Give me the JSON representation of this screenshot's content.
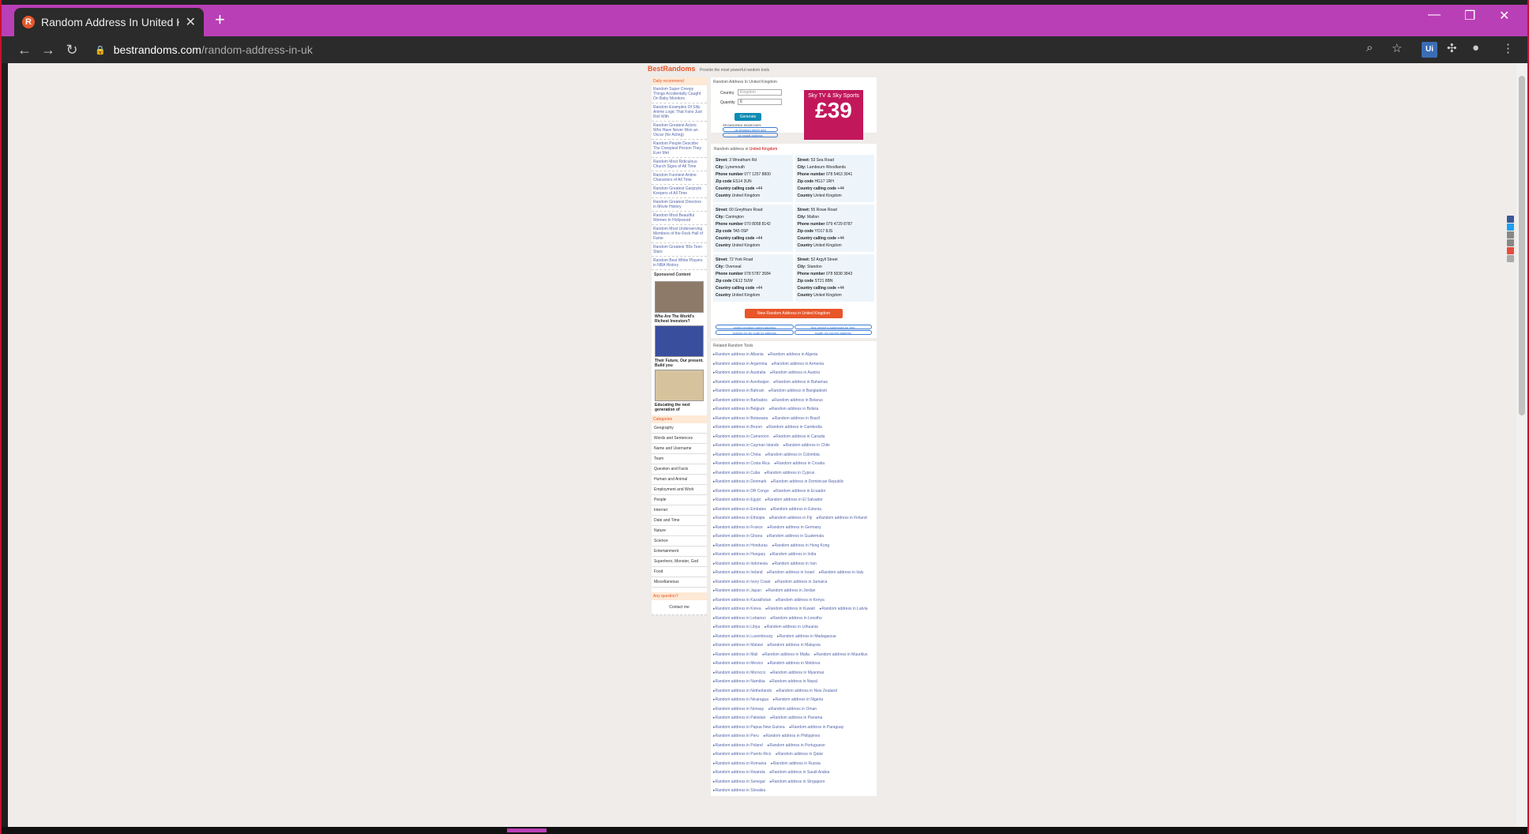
{
  "browser": {
    "tab_title": "Random Address In United Kingdom",
    "favicon": "R",
    "new_tab": "+",
    "url_domain": "bestrandoms.com",
    "url_path": "/random-address-in-uk",
    "ext_label": "Ui",
    "accent_color": "#b93fb6"
  },
  "site": {
    "logo": "BestRandoms",
    "tagline": "Provide the most powerful random tools",
    "sidebar": {
      "daily_header": "Daily recommend",
      "daily_items": [
        "Random Super Creepy Things Accidentally Caught On Baby Monitors",
        "Random Examples Of Silly Anime Logic That Fans Just Roll With",
        "Random Greatest Actors Who Have Never Won an Oscar (for Acting)",
        "Random People Describe The Creepiest Person They Ever Met",
        "Random Most Ridiculous Church Signs of All Time",
        "Random Funniest Anime Characters of All Time",
        "Random Greatest Gargoyle Keepers of All Time",
        "Random Greatest Directors in Movie History",
        "Random Most Beautiful Women In Hollywood",
        "Random Most Underserving Members of the Rock Hall of Fame",
        "Random Greatest '80s Teen Stars",
        "Random Best White Players in NBA History"
      ],
      "sponsored_header": "Sponsored Content",
      "sponsored": [
        "Who Are The World's Richest Investors?",
        "Their Future, Our present. Build you",
        "Educating the next generation of"
      ],
      "categories_header": "Categories",
      "categories": [
        "Geography",
        "Words and Sentences",
        "Name and Username",
        "Team",
        "Question and Facts",
        "Human and Animal",
        "Employment and Work",
        "People",
        "Internet",
        "Date and Time",
        "Nature",
        "Science",
        "Entertainment",
        "Superhero, Monster, God",
        "Food",
        "Miscellaneous"
      ],
      "question_header": "Any question?",
      "contact": "Contact me"
    },
    "main": {
      "breadcrumb": "Random Address In United Kingdom",
      "country_label": "Country",
      "country_value": "Kingdom",
      "quantity_label": "Quantity",
      "quantity_value": "6",
      "generate": "Generate",
      "sponsored_searches": "SPONSORED SEARCHES",
      "search_links": [
        "uk kingdom street add",
        "uk postal address"
      ],
      "ad_line1": "Sky TV & Sky Sports",
      "ad_price": "£39",
      "results_prefix": "Random address in",
      "results_country": "United Kingdom",
      "addresses": [
        {
          "street": "3 Wreatham Rd",
          "city": "Lynemouth",
          "phone": "077 1257 8800",
          "zip": "ES14 3UN",
          "calling": "+44",
          "country": "United Kingdom"
        },
        {
          "street": "53 Sea Road",
          "city": "Lambourn Woodlands",
          "phone": "078 5463 3941",
          "zip": "HG17 1RH",
          "calling": "+44",
          "country": "United Kingdom"
        },
        {
          "street": "60 Greyfriars Road",
          "city": "Carrington",
          "phone": "070 8058 8142",
          "zip": "TA5 0SP",
          "calling": "+44",
          "country": "United Kingdom"
        },
        {
          "street": "55 Rowe Road",
          "city": "Malton",
          "phone": "079 4729 8787",
          "zip": "YO17 8JS",
          "calling": "+44",
          "country": "United Kingdom"
        },
        {
          "street": "72 York Road",
          "city": "Overseal",
          "phone": "078 5787 3584",
          "zip": "DE12 5UW",
          "calling": "+44",
          "country": "United Kingdom"
        },
        {
          "street": "52 Argyll Street",
          "city": "Standon",
          "phone": "078 5838 3843",
          "zip": "ST21 8BN",
          "calling": "+44",
          "country": "United Kingdom"
        }
      ],
      "field_labels": {
        "street": "Street:",
        "city": "City:",
        "phone": "Phone number",
        "zip": "Zip code",
        "calling": "Country calling code",
        "country": "Country"
      },
      "new_button": "New Random Address in United Kingdom",
      "bottom_search_links": [
        "united kingdom street address",
        "find people's addresses for free",
        "looking for zip code by address",
        "locate my current address"
      ],
      "related_header": "Related Random Tools",
      "related": [
        "Random address in Albania",
        "Random address in Algeria",
        "Random address in Argentina",
        "Random address in Armenia",
        "Random address in Australia",
        "Random address in Austria",
        "Random address in Azerbaijan",
        "Random address in Bahamas",
        "Random address in Bahrain",
        "Random address in Bangladesh",
        "Random address in Barbados",
        "Random address in Belarus",
        "Random address in Belgium",
        "Random address in Bolivia",
        "Random address in Botswana",
        "Random address in Brazil",
        "Random address in Brunei",
        "Random address in Cambodia",
        "Random address in Cameroon",
        "Random address in Canada",
        "Random address in Cayman Islands",
        "Random address in Chile",
        "Random address in China",
        "Random address in Colombia",
        "Random address in Costa Rica",
        "Random address in Croatia",
        "Random address in Cuba",
        "Random address in Cyprus",
        "Random address in Denmark",
        "Random address in Dominican Republic",
        "Random address in DR Congo",
        "Random address in Ecuador",
        "Random address in Egypt",
        "Random address in El Salvador",
        "Random address in Emirates",
        "Random address in Estonia",
        "Random address in Ethiopia",
        "Random address in Fiji",
        "Random address in Finland",
        "Random address in France",
        "Random address in Germany",
        "Random address in Ghana",
        "Random address in Guatemala",
        "Random address in Honduras",
        "Random address in Hong Kong",
        "Random address in Hungary",
        "Random address in India",
        "Random address in Indonesia",
        "Random address in Iran",
        "Random address in Ireland",
        "Random address in Israel",
        "Random address in Italy",
        "Random address in Ivory Coast",
        "Random address in Jamaica",
        "Random address in Japan",
        "Random address in Jordan",
        "Random address in Kazakhstan",
        "Random address in Kenya",
        "Random address in Korea",
        "Random address in Kuwait",
        "Random address in Latvia",
        "Random address in Lebanon",
        "Random address in Lesotho",
        "Random address in Libya",
        "Random address in Lithuania",
        "Random address in Luxembourg",
        "Random address in Madagascar",
        "Random address in Malawi",
        "Random address in Malaysia",
        "Random address in Mali",
        "Random address in Malta",
        "Random address in Mauritius",
        "Random address in Mexico",
        "Random address in Moldova",
        "Random address in Morocco",
        "Random address in Myanmar",
        "Random address in Namibia",
        "Random address in Nepal",
        "Random address in Netherlands",
        "Random address in New Zealand",
        "Random address in Nicaragua",
        "Random address in Nigeria",
        "Random address in Norway",
        "Random address in Oman",
        "Random address in Pakistan",
        "Random address in Panama",
        "Random address in Papua New Guinea",
        "Random address in Paraguay",
        "Random address in Peru",
        "Random address in Philippines",
        "Random address in Poland",
        "Random address in Portuguese",
        "Random address in Puerto Rico",
        "Random address in Qatar",
        "Random address in Romania",
        "Random address in Russia",
        "Random address in Rwanda",
        "Random address in Saudi Arabia",
        "Random address in Senegal",
        "Random address in Singapore",
        "Random address in Slovakia"
      ]
    }
  }
}
